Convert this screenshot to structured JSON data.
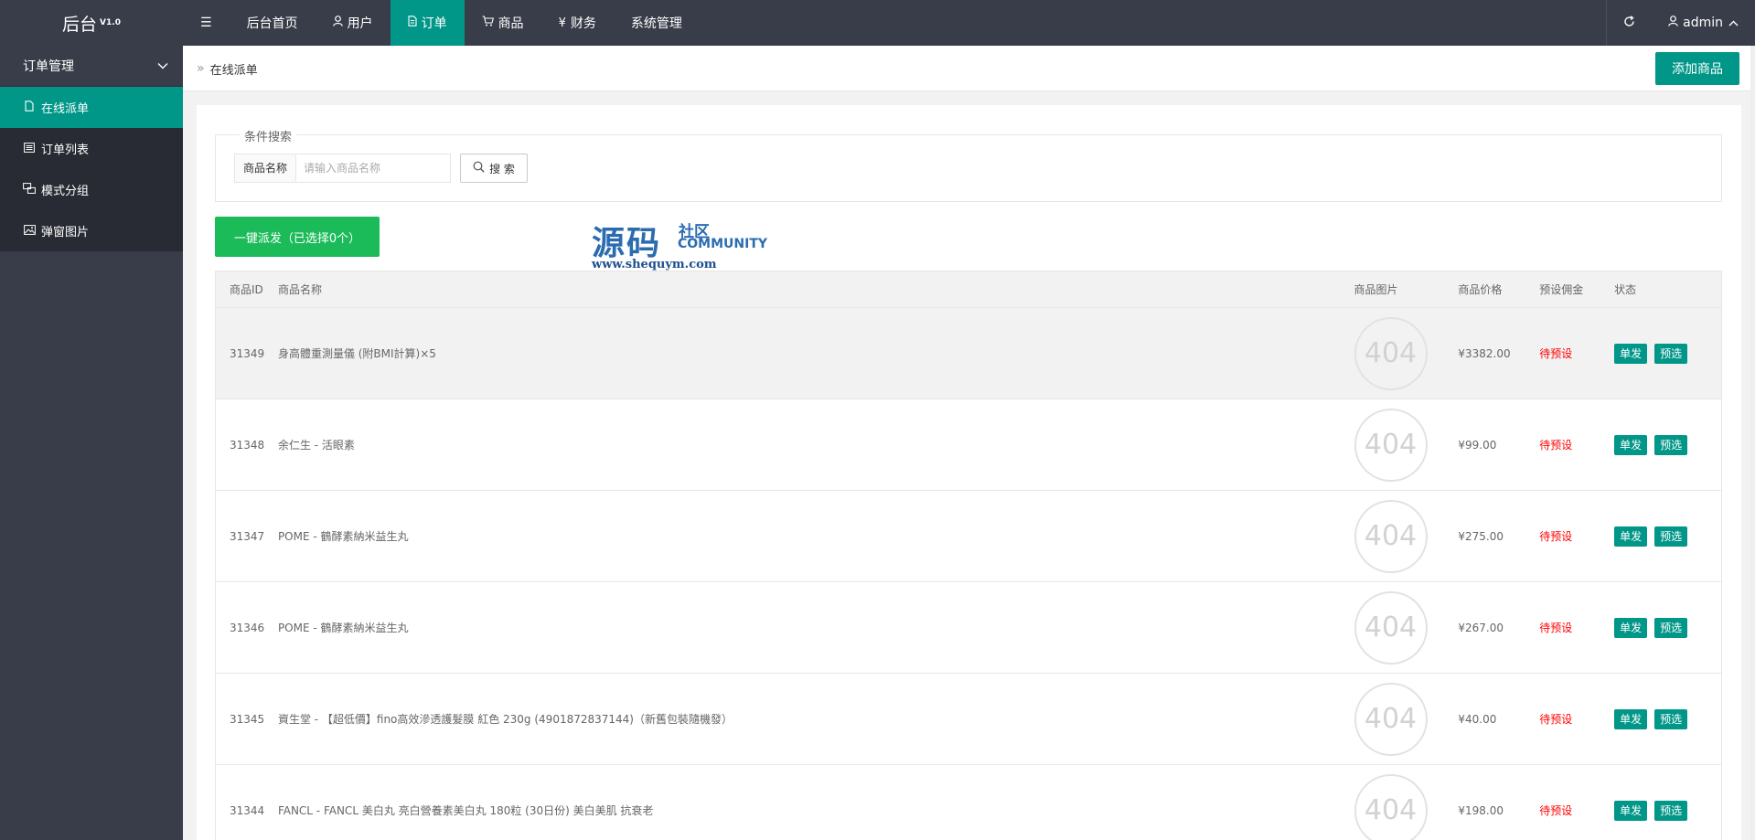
{
  "app": {
    "logo": "后台",
    "version": "V1.0"
  },
  "nav": {
    "toggle_icon": "menu-toggle-icon",
    "items": [
      {
        "label": "后台首页",
        "icon": ""
      },
      {
        "label": "用户",
        "icon": "user-icon"
      },
      {
        "label": "订单",
        "icon": "document-icon"
      },
      {
        "label": "商品",
        "icon": "cart-icon"
      },
      {
        "label": "财务",
        "icon": "yen-icon"
      },
      {
        "label": "系统管理",
        "icon": ""
      }
    ],
    "active_index": 2,
    "user": "admin"
  },
  "sidebar": {
    "group": "订单管理",
    "items": [
      {
        "label": "在线派单",
        "icon": "document-icon"
      },
      {
        "label": "订单列表",
        "icon": "list-icon"
      },
      {
        "label": "模式分组",
        "icon": "group-icon"
      },
      {
        "label": "弹窗图片",
        "icon": "image-icon"
      }
    ],
    "active_index": 0
  },
  "breadcrumb": "在线派单",
  "toolbar": {
    "add_label": "添加商品"
  },
  "search": {
    "legend": "条件搜索",
    "field_label": "商品名称",
    "placeholder": "请输入商品名称",
    "button": "搜 索"
  },
  "batch_button": "一键派发（已选择0个）",
  "watermark": {
    "big": "源码",
    "small": "社区",
    "community": "COMMUNITY",
    "url": "www.shequym.com"
  },
  "table": {
    "headers": [
      "商品ID",
      "商品名称",
      "商品图片",
      "商品价格",
      "预设佣金",
      "状态"
    ],
    "image_placeholder": "404",
    "action_single": "单发",
    "action_preset": "预选",
    "rows": [
      {
        "id": "31349",
        "name": "身高體重測量儀 (附BMI計算)×5",
        "price": "¥3382.00",
        "commission": "待预设"
      },
      {
        "id": "31348",
        "name": "余仁生 - 活眼素",
        "price": "¥99.00",
        "commission": "待预设"
      },
      {
        "id": "31347",
        "name": "POME - 鶴酵素納米益生丸",
        "price": "¥275.00",
        "commission": "待预设"
      },
      {
        "id": "31346",
        "name": "POME - 鶴酵素納米益生丸",
        "price": "¥267.00",
        "commission": "待预设"
      },
      {
        "id": "31345",
        "name": "資生堂 - 【超低價】fino高效滲透護髮膜 紅色 230g (4901872837144)（新舊包裝隨機發）",
        "price": "¥40.00",
        "commission": "待预设"
      },
      {
        "id": "31344",
        "name": "FANCL - FANCL 美白丸 亮白營養素美白丸 180粒 (30日份) 美白美肌 抗衰老",
        "price": "¥198.00",
        "commission": "待预设"
      }
    ]
  }
}
